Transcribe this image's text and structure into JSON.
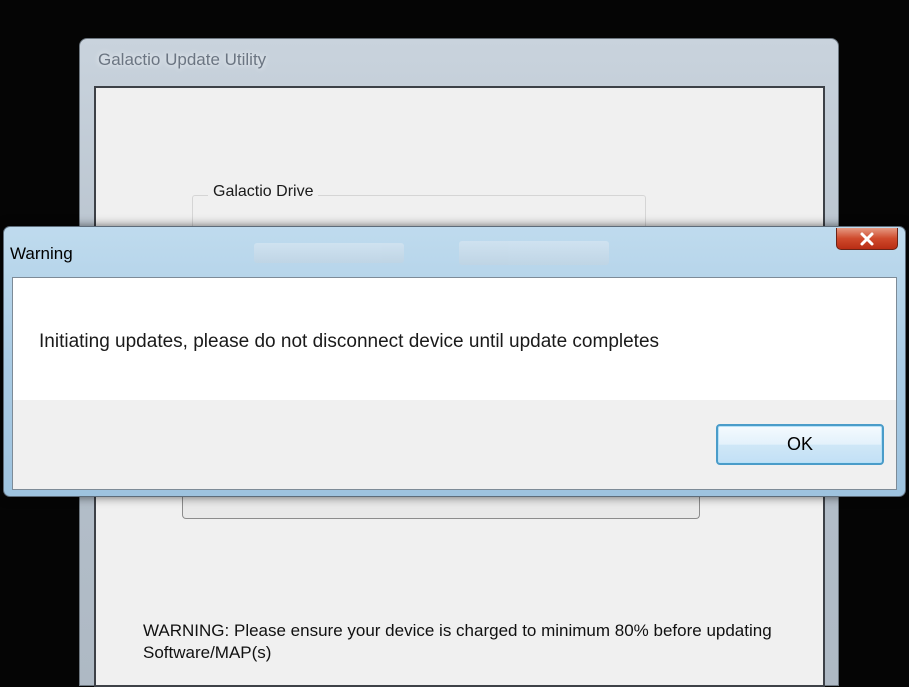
{
  "main_window": {
    "title": "Galactio Update Utility",
    "group_label": "Galactio Drive",
    "warning_text": "WARNING: Please ensure your device is charged to minimum 80% before updating Software/MAP(s)"
  },
  "dialog": {
    "title": "Warning",
    "message": "Initiating updates, please do not disconnect device until update completes",
    "ok_label": "OK",
    "close_icon": "close-icon",
    "close_color": "#c8402a",
    "ok_border_color": "#4a9cc9"
  }
}
